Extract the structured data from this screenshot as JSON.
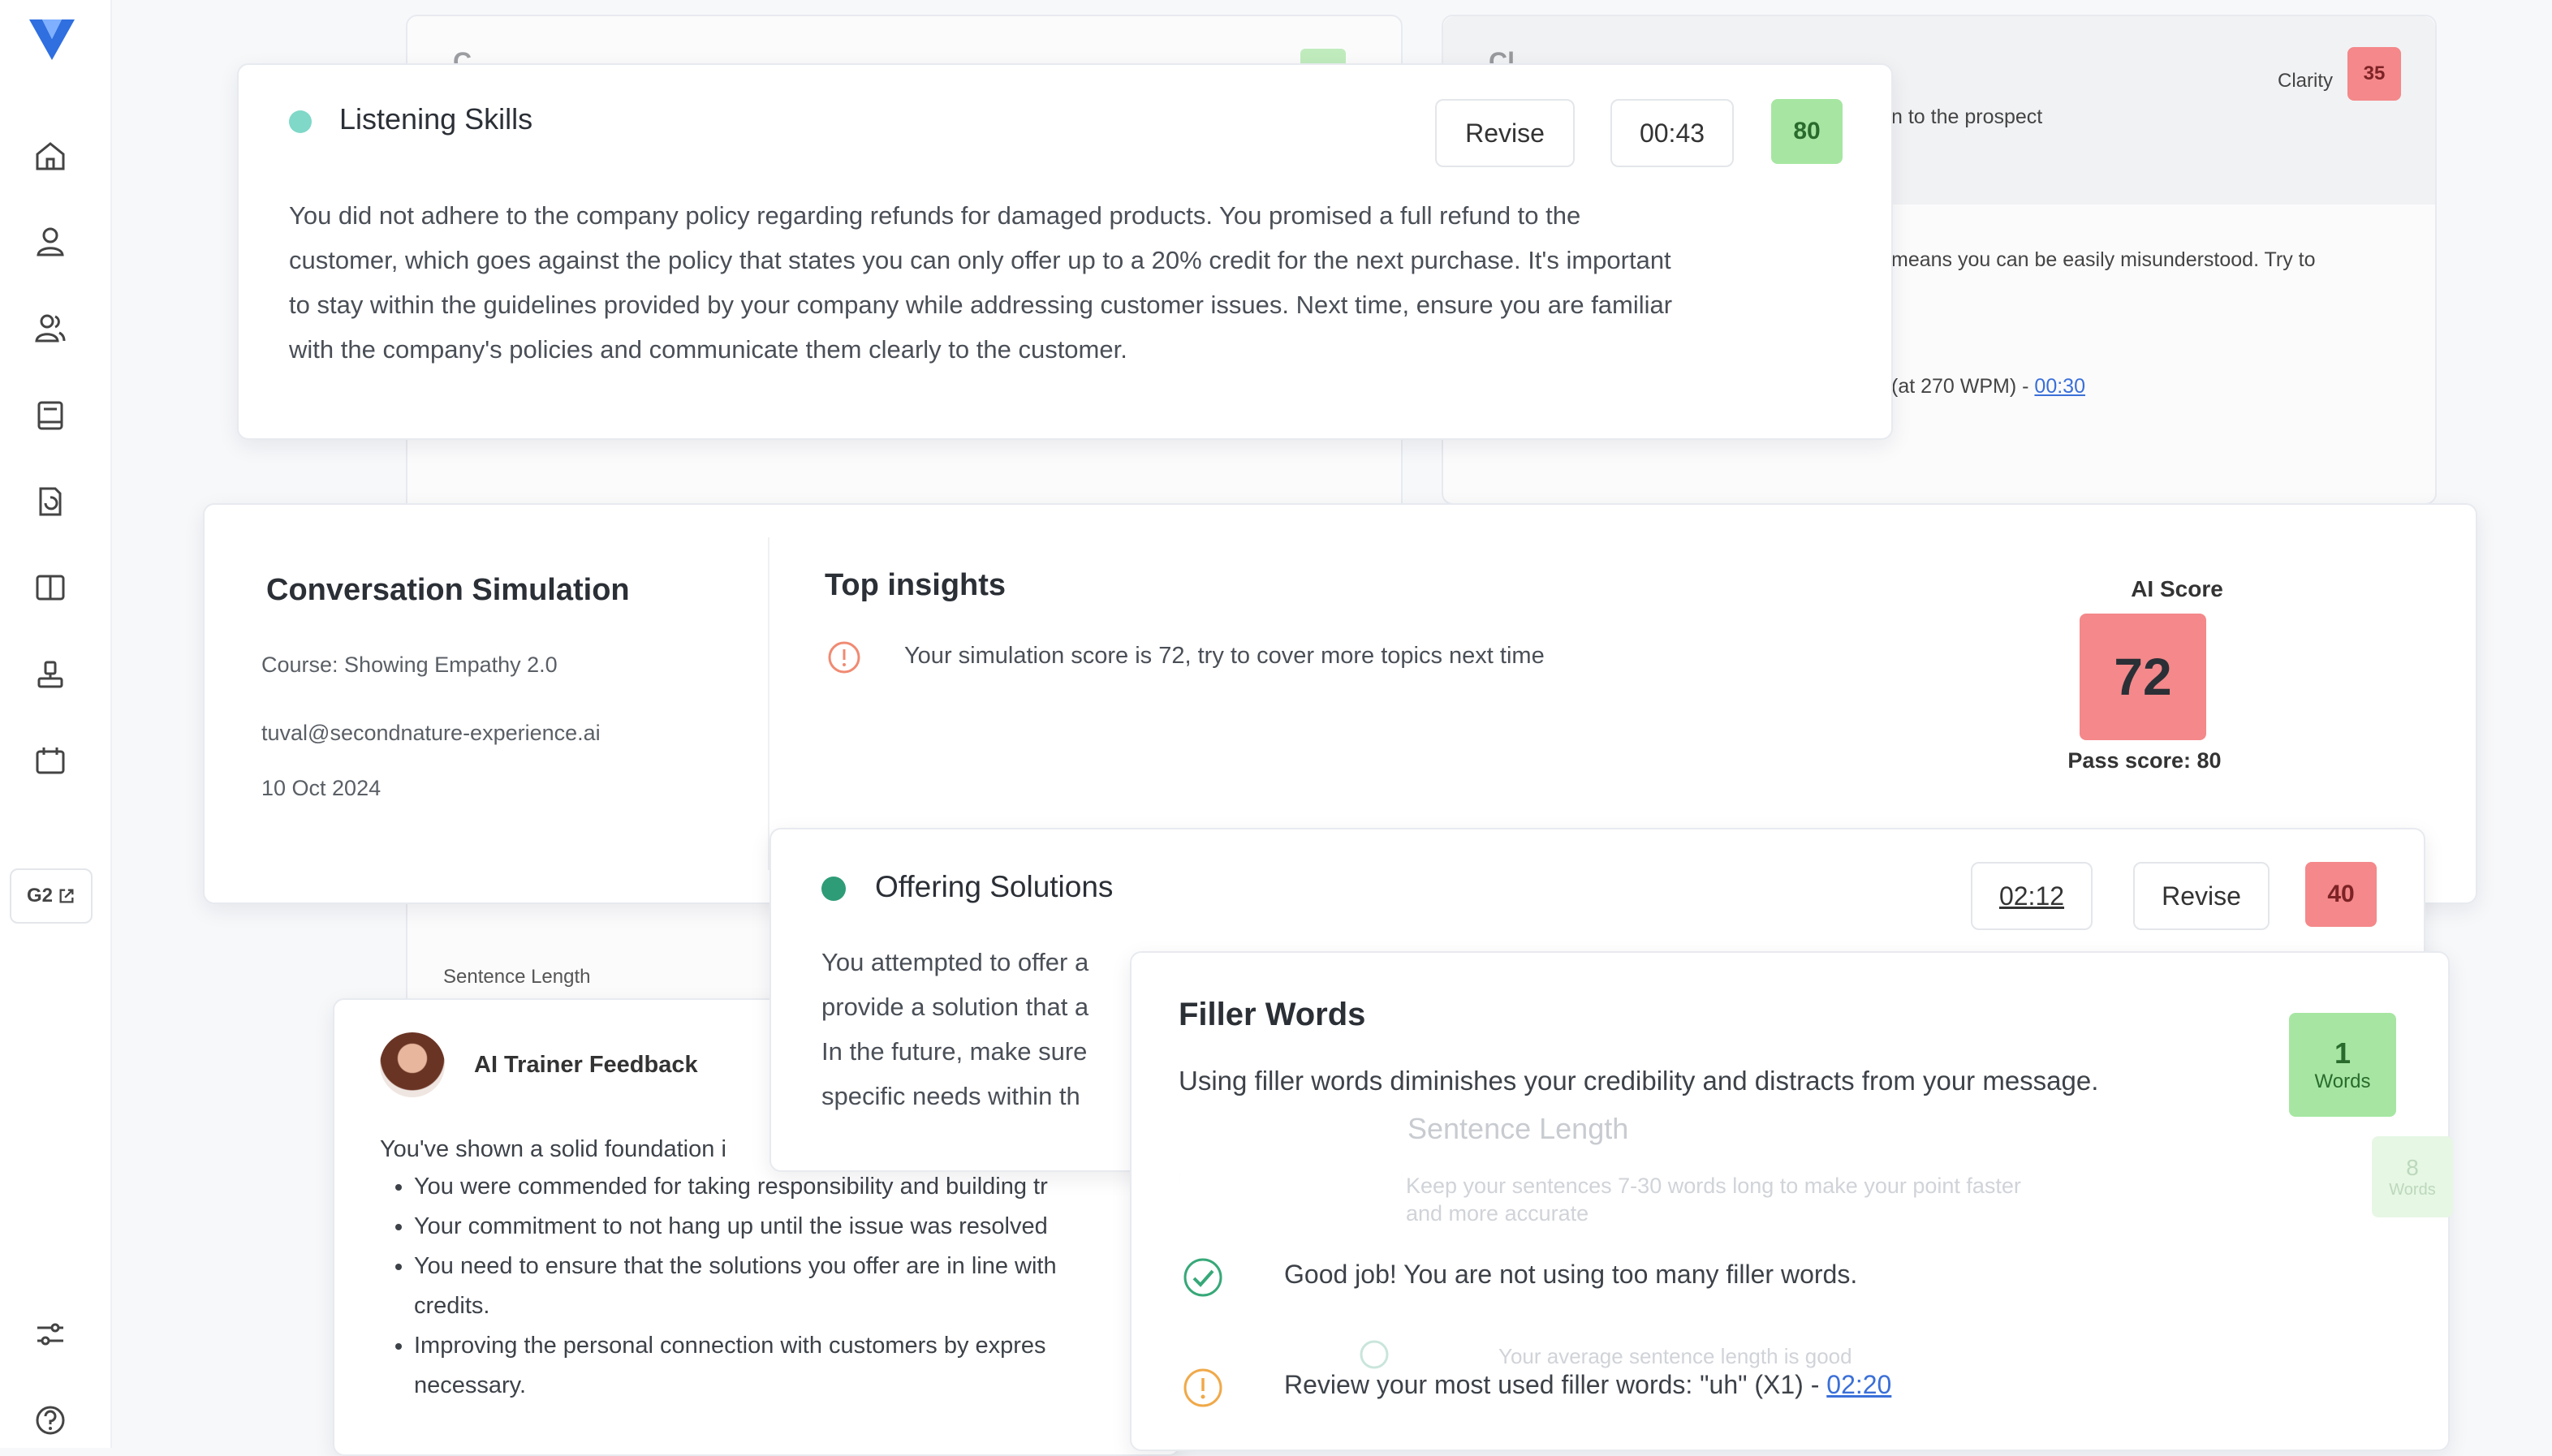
{
  "colors": {
    "accent": "#2f6fe0",
    "green_score": "#a6e6a2",
    "red_score": "#f4888a",
    "dot_teal": "#7fd8c8",
    "dot_green": "#2e9c77"
  },
  "sidebar": {
    "icons": [
      "home-icon",
      "user-icon",
      "users-icon",
      "book-icon",
      "refresh-doc-icon",
      "open-book-icon",
      "trophy-icon",
      "calendar-icon",
      "sliders-icon",
      "help-icon"
    ],
    "g2_label": "G2"
  },
  "bg_left": {
    "title_fragment": "C",
    "sentence_length_label": "Sentence Length"
  },
  "bg_right": {
    "title_fragment": "Cl",
    "clarity_label": "Clarity",
    "clarity_score": "35",
    "line1": "n to the prospect",
    "line2": "means you can be easily misunderstood. Try to",
    "line3_text": "(at 270 WPM) - ",
    "line3_link": "00:30"
  },
  "listening": {
    "title": "Listening Skills",
    "revise": "Revise",
    "time": "00:43",
    "score": "80",
    "text": "You did not adhere to the company policy regarding refunds for damaged products. You promised a full refund to the customer, which goes against the policy that states you  can only offer up to a 20% credit for the next purchase. It's important  to stay within the guidelines provided by your company while addressing customer issues. Next time, ensure you are familiar with the company's  policies and communicate them clearly to the customer."
  },
  "conversation": {
    "title": "Conversation Simulation",
    "course": "Course: Showing Empathy 2.0",
    "email": "tuval@secondnature-experience.ai",
    "date": "10 Oct 2024"
  },
  "insights": {
    "title": "Top insights",
    "item": "Your simulation score is 72, try to cover more topics next time",
    "ai_score_label": "AI Score",
    "ai_score": "72",
    "pass_score": "Pass score: 80"
  },
  "offering": {
    "title": "Offering Solutions",
    "time": "02:12",
    "revise": "Revise",
    "score": "40",
    "lines": [
      "You attempted to offer a",
      "provide a solution that a",
      "In the  future, make sure",
      "specific needs within th"
    ]
  },
  "trainer": {
    "title": "AI Trainer Feedback",
    "intro": "You've shown a solid foundation i",
    "bullets": [
      "You were commended for taking responsibility and building tr",
      "Your commitment to not hang up until the issue was resolved",
      "You need to ensure that the solutions you offer are in line with",
      "Improving the personal connection with customers by expres"
    ],
    "bullet3_cont": "credits.",
    "bullet4_cont": "necessary."
  },
  "filler": {
    "title": "Filler Words",
    "desc": "Using filler words diminishes your credibility and distracts from your message.",
    "count": "1",
    "count_unit": "Words",
    "good_text": "Good job! You are not using too many filler words.",
    "review_text": "Review your most used filler words: \"uh\" (X1) - ",
    "review_link": "02:20",
    "ghost_title": "Sentence Length",
    "ghost_desc_1": "Keep your sentences 7-30 words long to make your point faster",
    "ghost_desc_2": "and more accurate",
    "ghost_item": "Your average sentence length is good",
    "ghost_count": "8",
    "ghost_unit": "Words"
  }
}
